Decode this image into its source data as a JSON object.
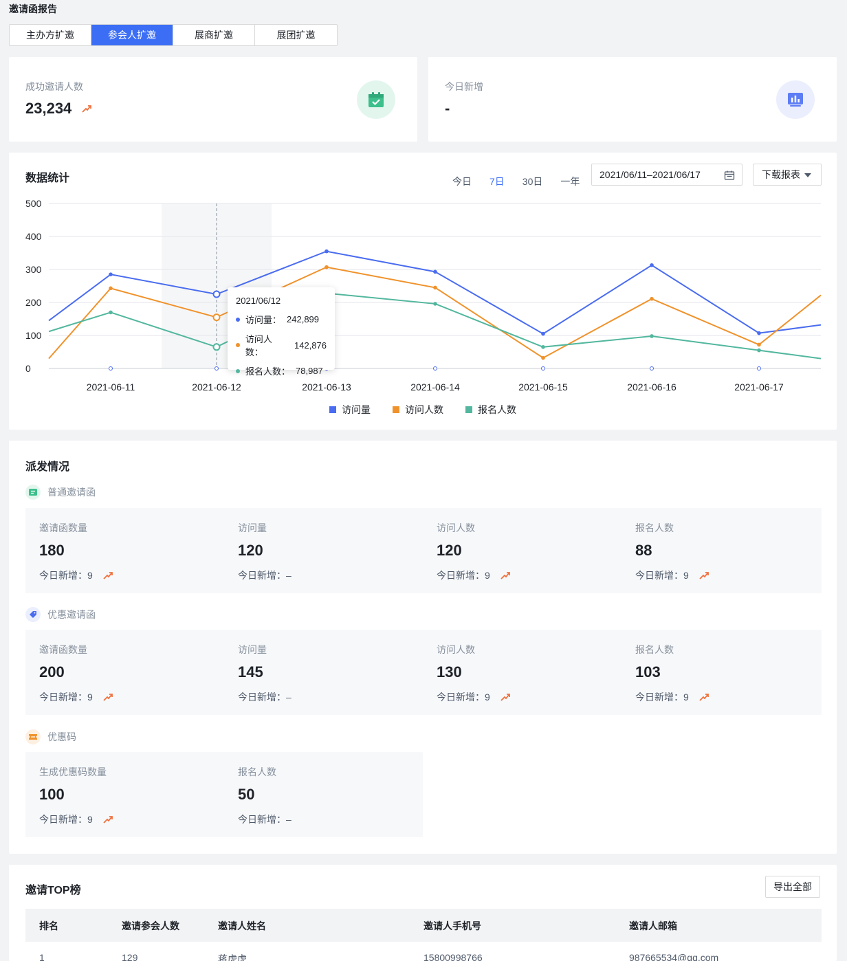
{
  "page": {
    "title": "邀请函报告"
  },
  "tabs": [
    "主办方扩邀",
    "参会人扩邀",
    "展商扩邀",
    "展团扩邀"
  ],
  "summary": {
    "success": {
      "label": "成功邀请人数",
      "value": "23,234"
    },
    "today": {
      "label": "今日新增",
      "value": "-"
    }
  },
  "stats": {
    "title": "数据统计",
    "ranges": [
      "今日",
      "7日",
      "30日",
      "一年"
    ],
    "active_range": "7日",
    "date_range": "2021/06/11–2021/06/17",
    "download_label": "下载报表",
    "tooltip": {
      "date": "2021/06/12",
      "rows": [
        {
          "label": "访问量：",
          "value": "242,899"
        },
        {
          "label": "访问人数：",
          "value": "142,876"
        },
        {
          "label": "报名人数：",
          "value": "78,987"
        }
      ]
    }
  },
  "chart_data": {
    "type": "line",
    "x": [
      "2021-06-11",
      "2021-06-12",
      "2021-06-13",
      "2021-06-14",
      "2021-06-15",
      "2021-06-16",
      "2021-06-17"
    ],
    "y_ticks": [
      "0",
      "100",
      "200",
      "300",
      "400",
      "500"
    ],
    "ylim": [
      0,
      500
    ],
    "series": [
      {
        "name": "访问量",
        "color": "#4a6cf0",
        "start": 145,
        "values": [
          285,
          225,
          355,
          293,
          105,
          313,
          107
        ],
        "end": 132
      },
      {
        "name": "访问人数",
        "color": "#f0922b",
        "start": 30,
        "values": [
          243,
          155,
          307,
          245,
          32,
          211,
          72
        ],
        "end": 222
      },
      {
        "name": "报名人数",
        "color": "#52b79e",
        "start": 112,
        "values": [
          170,
          65,
          228,
          196,
          65,
          98,
          55
        ],
        "end": 30
      }
    ],
    "legend_position": "bottom"
  },
  "distribution": {
    "title": "派发情况",
    "groups": [
      {
        "name": "普通邀请函",
        "metrics": [
          {
            "label": "邀请函数量",
            "value": "180",
            "new_label": "今日新增：",
            "new_value": "9"
          },
          {
            "label": "访问量",
            "value": "120",
            "new_label": "今日新增：",
            "new_value": "–"
          },
          {
            "label": "访问人数",
            "value": "120",
            "new_label": "今日新增：",
            "new_value": "9"
          },
          {
            "label": "报名人数",
            "value": "88",
            "new_label": "今日新增：",
            "new_value": "9"
          }
        ]
      },
      {
        "name": "优惠邀请函",
        "metrics": [
          {
            "label": "邀请函数量",
            "value": "200",
            "new_label": "今日新增：",
            "new_value": "9"
          },
          {
            "label": "访问量",
            "value": "145",
            "new_label": "今日新增：",
            "new_value": "–"
          },
          {
            "label": "访问人数",
            "value": "130",
            "new_label": "今日新增：",
            "new_value": "9"
          },
          {
            "label": "报名人数",
            "value": "103",
            "new_label": "今日新增：",
            "new_value": "9"
          }
        ]
      },
      {
        "name": "优惠码",
        "metrics": [
          {
            "label": "生成优惠码数量",
            "value": "100",
            "new_label": "今日新增：",
            "new_value": "9"
          },
          {
            "label": "报名人数",
            "value": "50",
            "new_label": "今日新增：",
            "new_value": "–"
          }
        ]
      }
    ]
  },
  "top": {
    "title": "邀请TOP榜",
    "export_label": "导出全部",
    "columns": [
      "排名",
      "邀请参会人数",
      "邀请人姓名",
      "邀请人手机号",
      "邀请人邮箱"
    ],
    "rows": [
      [
        "1",
        "129",
        "蒋虎虎",
        "15800998766",
        "987665534@qq.com"
      ]
    ]
  },
  "colors": {
    "accent": "#3b6ef5",
    "trend_up": "#f0703c"
  }
}
